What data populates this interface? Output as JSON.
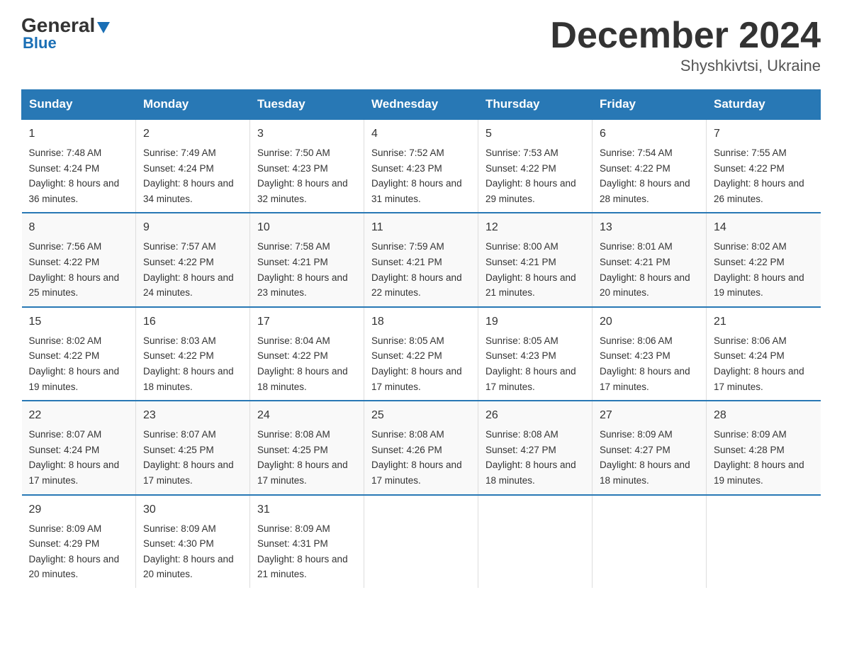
{
  "logo": {
    "general": "General",
    "blue": "Blue"
  },
  "header": {
    "month": "December 2024",
    "location": "Shyshkivtsi, Ukraine"
  },
  "weekdays": [
    "Sunday",
    "Monday",
    "Tuesday",
    "Wednesday",
    "Thursday",
    "Friday",
    "Saturday"
  ],
  "weeks": [
    [
      {
        "day": "1",
        "sunrise": "7:48 AM",
        "sunset": "4:24 PM",
        "daylight": "8 hours and 36 minutes."
      },
      {
        "day": "2",
        "sunrise": "7:49 AM",
        "sunset": "4:24 PM",
        "daylight": "8 hours and 34 minutes."
      },
      {
        "day": "3",
        "sunrise": "7:50 AM",
        "sunset": "4:23 PM",
        "daylight": "8 hours and 32 minutes."
      },
      {
        "day": "4",
        "sunrise": "7:52 AM",
        "sunset": "4:23 PM",
        "daylight": "8 hours and 31 minutes."
      },
      {
        "day": "5",
        "sunrise": "7:53 AM",
        "sunset": "4:22 PM",
        "daylight": "8 hours and 29 minutes."
      },
      {
        "day": "6",
        "sunrise": "7:54 AM",
        "sunset": "4:22 PM",
        "daylight": "8 hours and 28 minutes."
      },
      {
        "day": "7",
        "sunrise": "7:55 AM",
        "sunset": "4:22 PM",
        "daylight": "8 hours and 26 minutes."
      }
    ],
    [
      {
        "day": "8",
        "sunrise": "7:56 AM",
        "sunset": "4:22 PM",
        "daylight": "8 hours and 25 minutes."
      },
      {
        "day": "9",
        "sunrise": "7:57 AM",
        "sunset": "4:22 PM",
        "daylight": "8 hours and 24 minutes."
      },
      {
        "day": "10",
        "sunrise": "7:58 AM",
        "sunset": "4:21 PM",
        "daylight": "8 hours and 23 minutes."
      },
      {
        "day": "11",
        "sunrise": "7:59 AM",
        "sunset": "4:21 PM",
        "daylight": "8 hours and 22 minutes."
      },
      {
        "day": "12",
        "sunrise": "8:00 AM",
        "sunset": "4:21 PM",
        "daylight": "8 hours and 21 minutes."
      },
      {
        "day": "13",
        "sunrise": "8:01 AM",
        "sunset": "4:21 PM",
        "daylight": "8 hours and 20 minutes."
      },
      {
        "day": "14",
        "sunrise": "8:02 AM",
        "sunset": "4:22 PM",
        "daylight": "8 hours and 19 minutes."
      }
    ],
    [
      {
        "day": "15",
        "sunrise": "8:02 AM",
        "sunset": "4:22 PM",
        "daylight": "8 hours and 19 minutes."
      },
      {
        "day": "16",
        "sunrise": "8:03 AM",
        "sunset": "4:22 PM",
        "daylight": "8 hours and 18 minutes."
      },
      {
        "day": "17",
        "sunrise": "8:04 AM",
        "sunset": "4:22 PM",
        "daylight": "8 hours and 18 minutes."
      },
      {
        "day": "18",
        "sunrise": "8:05 AM",
        "sunset": "4:22 PM",
        "daylight": "8 hours and 17 minutes."
      },
      {
        "day": "19",
        "sunrise": "8:05 AM",
        "sunset": "4:23 PM",
        "daylight": "8 hours and 17 minutes."
      },
      {
        "day": "20",
        "sunrise": "8:06 AM",
        "sunset": "4:23 PM",
        "daylight": "8 hours and 17 minutes."
      },
      {
        "day": "21",
        "sunrise": "8:06 AM",
        "sunset": "4:24 PM",
        "daylight": "8 hours and 17 minutes."
      }
    ],
    [
      {
        "day": "22",
        "sunrise": "8:07 AM",
        "sunset": "4:24 PM",
        "daylight": "8 hours and 17 minutes."
      },
      {
        "day": "23",
        "sunrise": "8:07 AM",
        "sunset": "4:25 PM",
        "daylight": "8 hours and 17 minutes."
      },
      {
        "day": "24",
        "sunrise": "8:08 AM",
        "sunset": "4:25 PM",
        "daylight": "8 hours and 17 minutes."
      },
      {
        "day": "25",
        "sunrise": "8:08 AM",
        "sunset": "4:26 PM",
        "daylight": "8 hours and 17 minutes."
      },
      {
        "day": "26",
        "sunrise": "8:08 AM",
        "sunset": "4:27 PM",
        "daylight": "8 hours and 18 minutes."
      },
      {
        "day": "27",
        "sunrise": "8:09 AM",
        "sunset": "4:27 PM",
        "daylight": "8 hours and 18 minutes."
      },
      {
        "day": "28",
        "sunrise": "8:09 AM",
        "sunset": "4:28 PM",
        "daylight": "8 hours and 19 minutes."
      }
    ],
    [
      {
        "day": "29",
        "sunrise": "8:09 AM",
        "sunset": "4:29 PM",
        "daylight": "8 hours and 20 minutes."
      },
      {
        "day": "30",
        "sunrise": "8:09 AM",
        "sunset": "4:30 PM",
        "daylight": "8 hours and 20 minutes."
      },
      {
        "day": "31",
        "sunrise": "8:09 AM",
        "sunset": "4:31 PM",
        "daylight": "8 hours and 21 minutes."
      },
      null,
      null,
      null,
      null
    ]
  ]
}
